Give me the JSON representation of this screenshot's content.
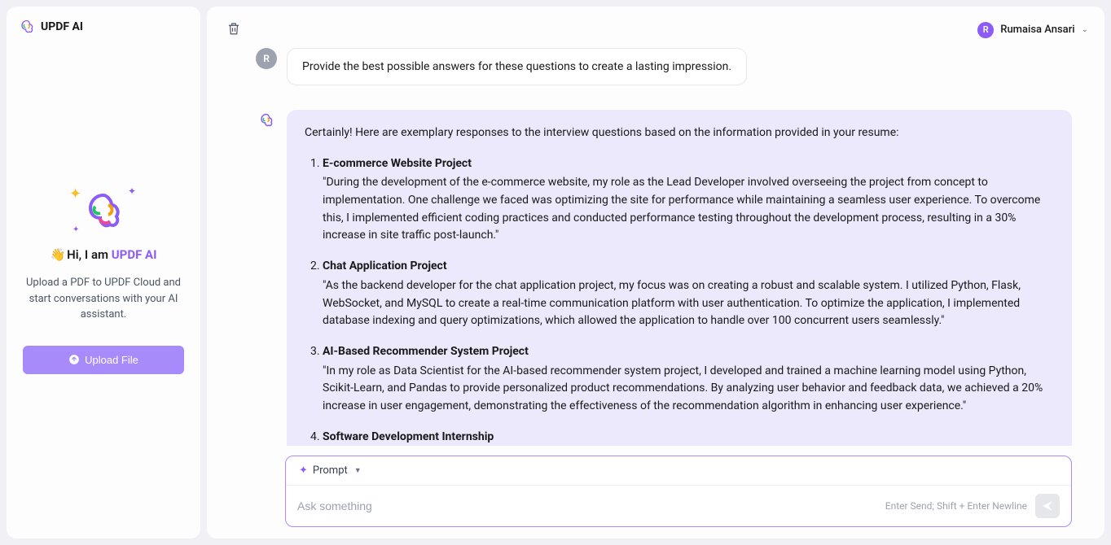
{
  "sidebar": {
    "brand": "UPDF AI",
    "greeting_prefix": "Hi, I am ",
    "greeting_name": "UPDF AI",
    "description": "Upload a PDF to UPDF Cloud and start conversations with your AI assistant.",
    "upload_label": "Upload File"
  },
  "header": {
    "user_initial": "R",
    "user_name": "Rumaisa Ansari"
  },
  "chat": {
    "user_message": "Provide the best possible answers for these questions to create a lasting impression.",
    "ai_intro": "Certainly! Here are exemplary responses to the interview questions based on the information provided in your resume:",
    "ai_items": [
      {
        "title": "E-commerce Website Project",
        "body": "\"During the development of the e-commerce website, my role as the Lead Developer involved overseeing the project from concept to implementation. One challenge we faced was optimizing the site for performance while maintaining a seamless user experience. To overcome this, I implemented efficient coding practices and conducted performance testing throughout the development process, resulting in a 30% increase in site traffic post-launch.\""
      },
      {
        "title": "Chat Application Project",
        "body": "\"As the backend developer for the chat application project, my focus was on creating a robust and scalable system. I utilized Python, Flask, WebSocket, and MySQL to create a real-time communication platform with user authentication. To optimize the application, I implemented database indexing and query optimizations, which allowed the application to handle over 100 concurrent users seamlessly.\""
      },
      {
        "title": "AI-Based Recommender System Project",
        "body": "\"In my role as Data Scientist for the AI-based recommender system project, I developed and trained a machine learning model using Python, Scikit-Learn, and Pandas to provide personalized product recommendations. By analyzing user behavior and feedback data, we achieved a 20% increase in user engagement, demonstrating the effectiveness of the recommendation algorithm in enhancing user experience.\""
      },
      {
        "title": "Software Development Internship",
        "body": ""
      }
    ]
  },
  "input": {
    "prompt_label": "Prompt",
    "placeholder": "Ask something",
    "hint": "Enter Send; Shift + Enter Newline"
  }
}
